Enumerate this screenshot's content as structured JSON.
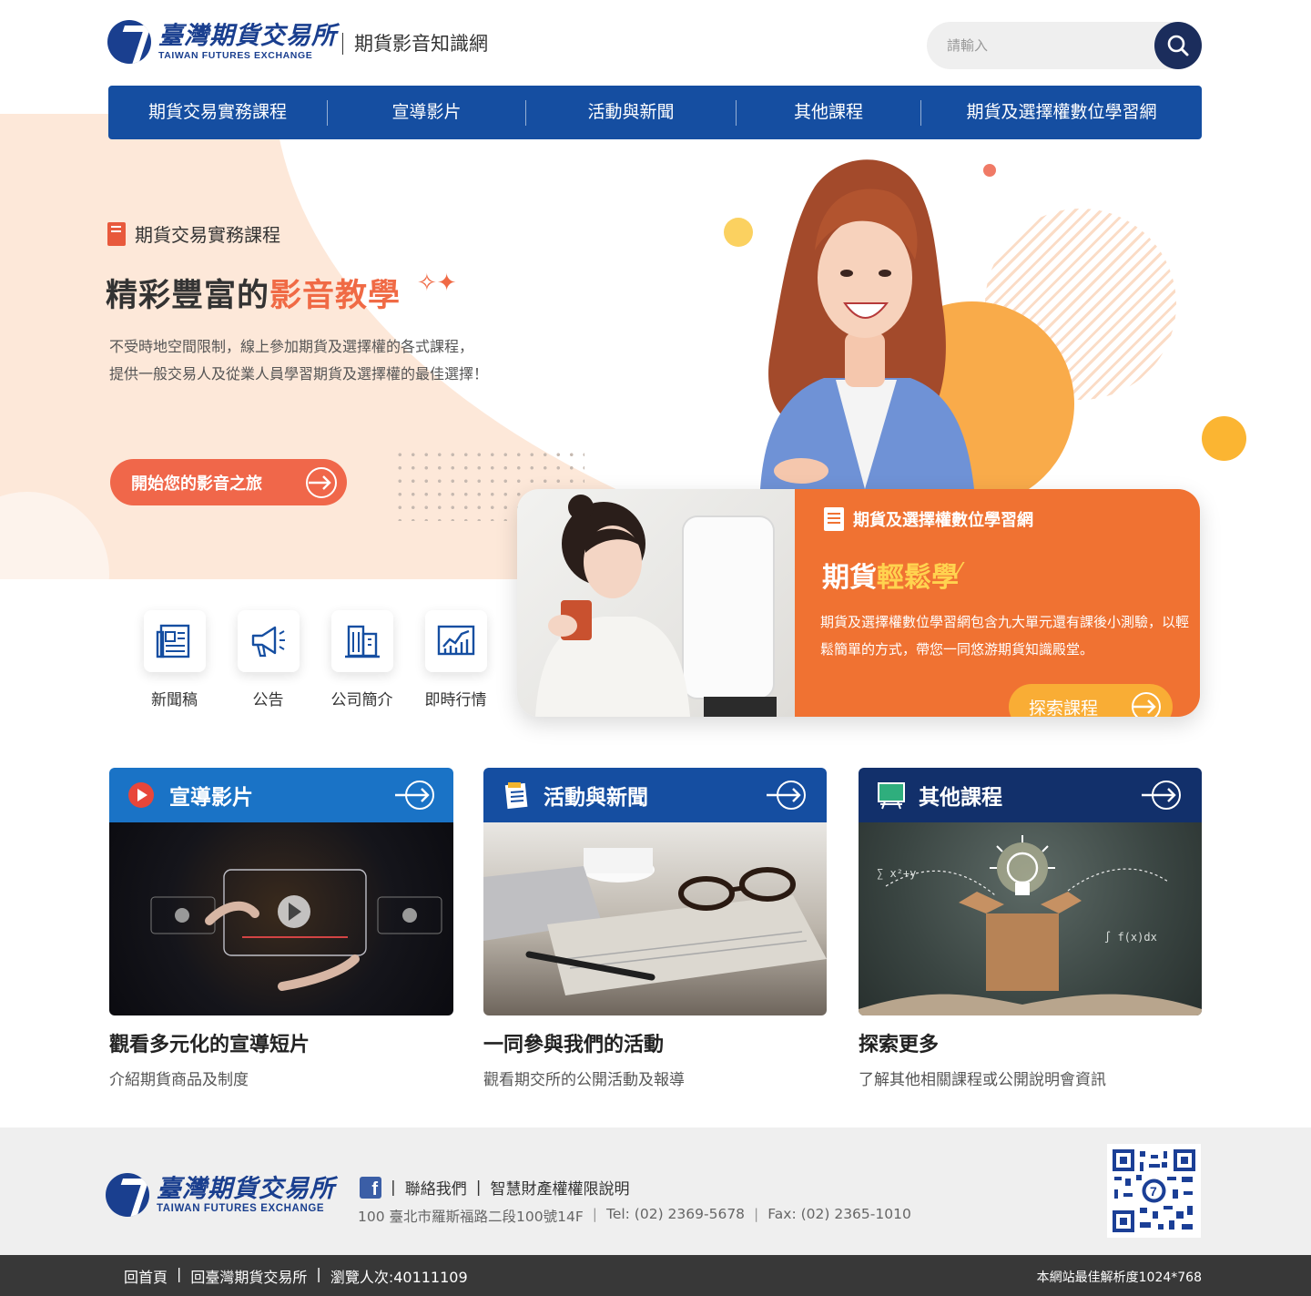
{
  "header": {
    "logo_cn": "臺灣期貨交易所",
    "logo_en": "TAIWAN FUTURES EXCHANGE",
    "site_title": "期貨影音知識網",
    "search_placeholder": "請輸入"
  },
  "nav": {
    "items": [
      "期貨交易實務課程",
      "宣導影片",
      "活動與新聞",
      "其他課程",
      "期貨及選擇權數位學習網"
    ]
  },
  "hero": {
    "kicker": "期貨交易實務課程",
    "title_plain": "精彩豐富的",
    "title_highlight": "影音教學",
    "desc_line1": "不受時地空間限制，線上參加期貨及選擇權的各式課程，",
    "desc_line2": "提供一般交易人及從業人員學習期貨及選擇權的最佳選擇！",
    "button_label": "開始您的影音之旅"
  },
  "feature": {
    "kicker": "期貨及選擇權數位學習網",
    "title_plain": "期貨",
    "title_highlight": "輕鬆學",
    "desc": "期貨及選擇權數位學習網包含九大單元還有課後小測驗，以輕鬆簡單的方式，帶您一同悠游期貨知識殿堂。",
    "button_label": "探索課程"
  },
  "quick_links": [
    {
      "label": "新聞稿",
      "icon": "newspaper-icon"
    },
    {
      "label": "公告",
      "icon": "megaphone-icon"
    },
    {
      "label": "公司簡介",
      "icon": "building-icon"
    },
    {
      "label": "即時行情",
      "icon": "chart-icon"
    }
  ],
  "cards": [
    {
      "head": "宣導影片",
      "title": "觀看多元化的宣導短片",
      "sub": "介紹期貨商品及制度",
      "color": "#1a73c6",
      "icon": "play-icon"
    },
    {
      "head": "活動與新聞",
      "title": "一同參與我們的活動",
      "sub": "觀看期交所的公開活動及報導",
      "color": "#154ea1",
      "icon": "news-icon"
    },
    {
      "head": "其他課程",
      "title": "探索更多",
      "sub": "了解其他相關課程或公開說明會資訊",
      "color": "#12306b",
      "icon": "blackboard-icon"
    }
  ],
  "footer": {
    "links": [
      "聯絡我們",
      "智慧財產權權限說明"
    ],
    "address": "100 臺北市羅斯福路二段100號14F",
    "tel": "Tel: (02) 2369-5678",
    "fax": "Fax: (02) 2365-1010"
  },
  "bottom_bar": {
    "home": "回首頁",
    "taifex": "回臺灣期貨交易所",
    "visitors": "瀏覽人次:40111109",
    "note": "本網站最佳解析度1024*768"
  },
  "colors": {
    "nav": "#154ea1",
    "hero_bg": "#fde8d9",
    "accent_red": "#f0674a",
    "feature_orange": "#f07232",
    "feature_button": "#f9ad35"
  }
}
